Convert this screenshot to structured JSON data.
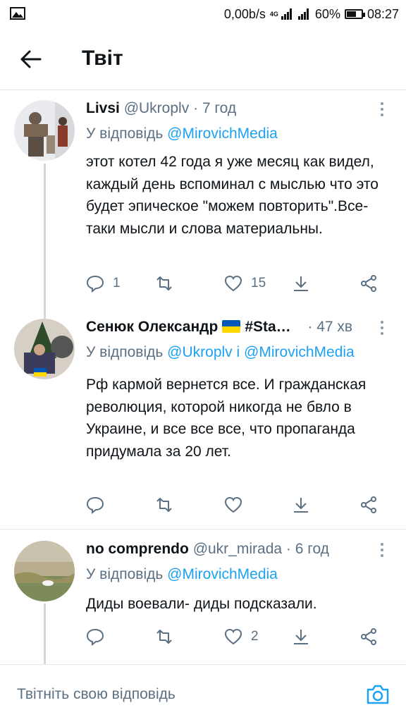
{
  "status_bar": {
    "speed": "0,00b/s",
    "network": "4G",
    "battery_percent": "60%",
    "battery_level": 0.6,
    "time": "08:27"
  },
  "header": {
    "title": "Твіт"
  },
  "tweets": [
    {
      "name": "Livsi",
      "handle": "@Ukroplv",
      "dot": "·",
      "time": "7 год",
      "reply_prefix": "У відповідь",
      "mentions": [
        "@MirovichMedia"
      ],
      "text": "этот котел 42 года я уже месяц как видел, каждый день вспоминал с мыслью что это будет эпическое \"можем повторить\".Все-таки мысли и слова материальны.",
      "reply_count": "1",
      "retweet_count": "",
      "like_count": "15"
    },
    {
      "name": "Сенюк Олександр",
      "name_suffix": "#Sta…",
      "handle": "",
      "dot": "·",
      "time": "47 хв",
      "reply_prefix": "У відповідь",
      "mentions": [
        "@Ukroplv",
        "@MirovichMedia"
      ],
      "mention_joiner": "і",
      "text": "Рф кармой вернется все. И гражданская революция, которой никогда не бвло в Украине, и все все все, что пропаганда придумала за 20 лет.",
      "reply_count": "",
      "retweet_count": "",
      "like_count": ""
    },
    {
      "name": "no comprendo",
      "handle": "@ukr_mirada",
      "dot": "·",
      "time": "6 год",
      "reply_prefix": "У відповідь",
      "mentions": [
        "@MirovichMedia"
      ],
      "text": "Диды воевали- диды подсказали.",
      "reply_count": "",
      "retweet_count": "",
      "like_count": "2"
    }
  ],
  "compose": {
    "placeholder": "Твітніть свою відповідь"
  },
  "colors": {
    "accent": "#1da1f2",
    "secondary_text": "#5b7083",
    "divider": "#e1e8ed",
    "flag_blue": "#0057b7",
    "flag_yellow": "#ffd700"
  },
  "icons": [
    "gallery-icon",
    "signal-icon",
    "battery-icon",
    "back-arrow-icon",
    "more-icon",
    "reply-icon",
    "retweet-icon",
    "like-icon",
    "bookmark-download-icon",
    "share-icon",
    "camera-icon"
  ]
}
